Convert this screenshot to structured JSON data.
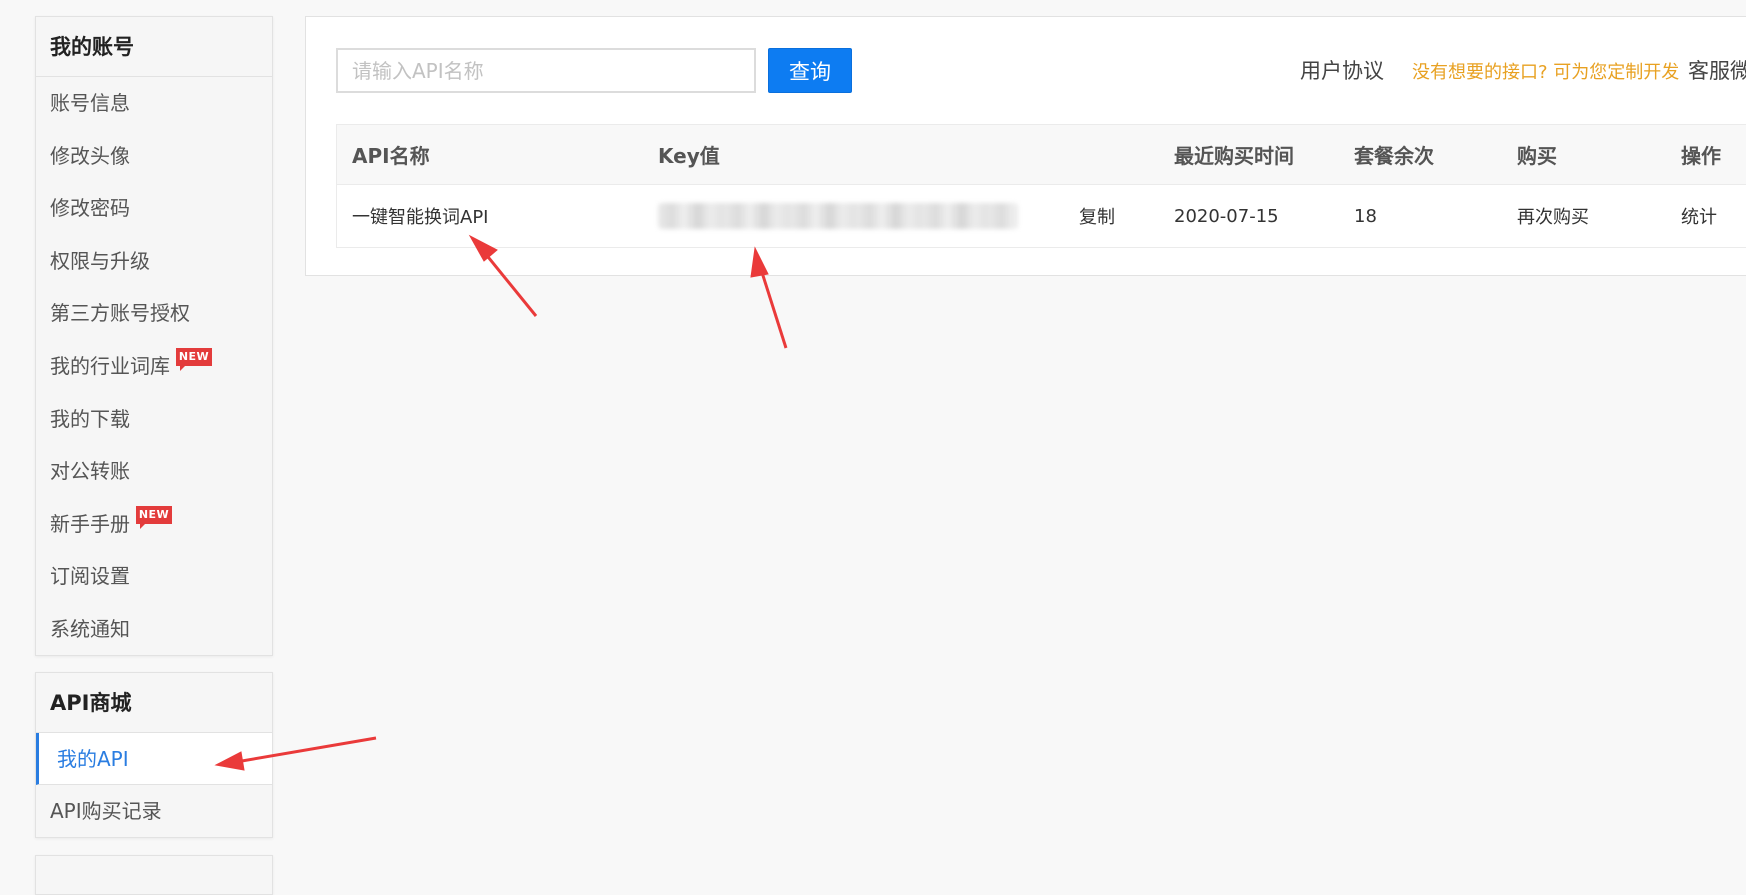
{
  "sidebar": {
    "account_title": "我的账号",
    "account_items": [
      {
        "label": "账号信息"
      },
      {
        "label": "修改头像"
      },
      {
        "label": "修改密码"
      },
      {
        "label": "权限与升级"
      },
      {
        "label": "第三方账号授权"
      },
      {
        "label": "我的行业词库",
        "badge": "NEW"
      },
      {
        "label": "我的下载"
      },
      {
        "label": "对公转账"
      },
      {
        "label": "新手手册",
        "badge": "NEW"
      },
      {
        "label": "订阅设置"
      },
      {
        "label": "系统通知"
      }
    ],
    "api_title": "API商城",
    "api_items": [
      {
        "label": "我的API",
        "active": true
      },
      {
        "label": "API购买记录"
      }
    ]
  },
  "search": {
    "placeholder": "请输入API名称",
    "value": "",
    "button_label": "查询"
  },
  "top_links": {
    "agreement": "用户协议",
    "custom": "没有想要的接口? 可为您定制开发",
    "service": "客服微"
  },
  "table": {
    "headers": {
      "name": "API名称",
      "key": "Key值",
      "date": "最近购买时间",
      "remain": "套餐余次",
      "buy": "购买",
      "op": "操作"
    },
    "rows": [
      {
        "name": "一键智能换词API",
        "copy": "复制",
        "date": "2020-07-15",
        "remain": "18",
        "buy": "再次购买",
        "op": "统计"
      }
    ]
  },
  "colors": {
    "accent": "#2a7de1",
    "button": "#0d7cf2",
    "highlight": "#e8a122",
    "badge": "#e33b3b",
    "arrow": "#ea3a3a"
  }
}
